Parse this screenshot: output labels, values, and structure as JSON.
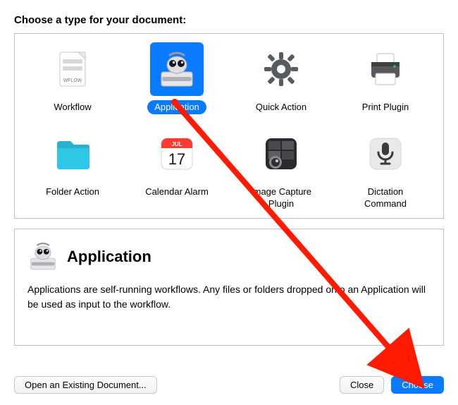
{
  "header": {
    "title": "Choose a type for your document:"
  },
  "types": {
    "selected_index": 1,
    "items": [
      {
        "id": "workflow",
        "label": "Workflow",
        "icon": "workflow-icon"
      },
      {
        "id": "application",
        "label": "Application",
        "icon": "automator-icon"
      },
      {
        "id": "quick-action",
        "label": "Quick Action",
        "icon": "gear-icon"
      },
      {
        "id": "print-plugin",
        "label": "Print Plugin",
        "icon": "printer-icon"
      },
      {
        "id": "folder-action",
        "label": "Folder Action",
        "icon": "folder-icon"
      },
      {
        "id": "calendar-alarm",
        "label": "Calendar Alarm",
        "icon": "calendar-icon",
        "cal_month": "JUL",
        "cal_day": "17"
      },
      {
        "id": "image-capture-plugin",
        "label": "Image Capture Plugin",
        "icon": "image-capture-icon"
      },
      {
        "id": "dictation-command",
        "label": "Dictation Command",
        "icon": "microphone-icon"
      }
    ]
  },
  "description": {
    "icon": "automator-icon",
    "title": "Application",
    "text": "Applications are self-running workflows. Any files or folders dropped onto an Application will be used as input to the workflow."
  },
  "footer": {
    "open_existing_label": "Open an Existing Document...",
    "close_label": "Close",
    "choose_label": "Choose"
  },
  "colors": {
    "selection": "#0a7aff",
    "border": "#c0c0c0",
    "arrow": "#ff1a00"
  }
}
